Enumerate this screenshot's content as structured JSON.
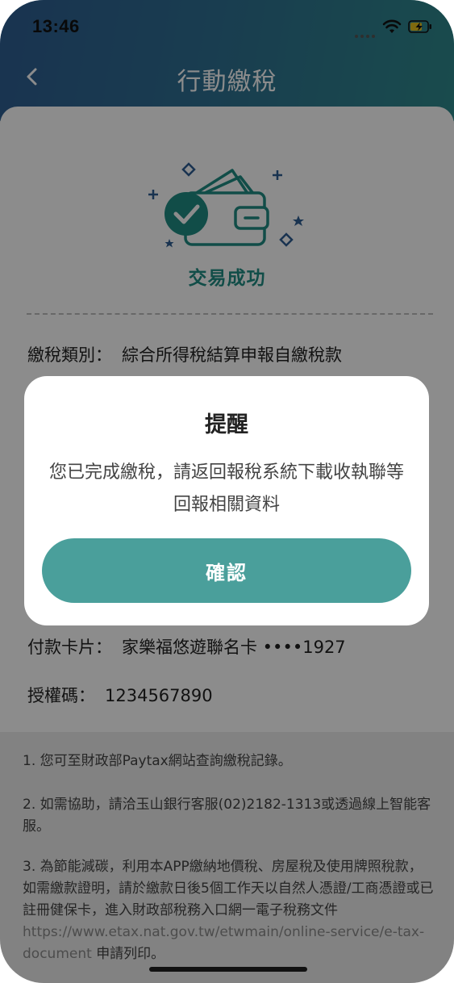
{
  "status_bar": {
    "time": "13:46"
  },
  "nav": {
    "title": "行動繳稅"
  },
  "result": {
    "message": "交易成功"
  },
  "details": [
    {
      "label": "繳稅類別：",
      "value": "綜合所得稅結算申報自繳稅款"
    },
    {
      "label": "付款卡片：",
      "value": "家樂福悠遊聯名卡 ••••1927"
    },
    {
      "label": "授權碼：",
      "value": "1234567890"
    }
  ],
  "notes": {
    "n1": "1. 您可至財政部Paytax網站查詢繳稅記錄。",
    "n2": "2. 如需協助，請洽玉山銀行客服(02)2182-1313或透過線上智能客服。",
    "n3_text": "3. 為節能減碳，利用本APP繳納地價稅、房屋稅及使用牌照稅款，如需繳款證明，請於繳款日後5個工作天以自然人憑證/工商憑證或已註冊健保卡，進入財政部稅務入口網一電子稅務文件",
    "n3_link": "https://www.etax.nat.gov.tw/etwmain/online-service/e-tax-document",
    "n3_tail": "申請列印。"
  },
  "modal": {
    "title": "提醒",
    "message": "您已完成繳稅，請返回報稅系統下載收執聯等回報相關資料",
    "confirm_label": "確認"
  },
  "colors": {
    "accent": "#1f8c83",
    "button": "#4a9f9b",
    "header_start": "#2f5e93",
    "header_end": "#2f8a8c"
  }
}
